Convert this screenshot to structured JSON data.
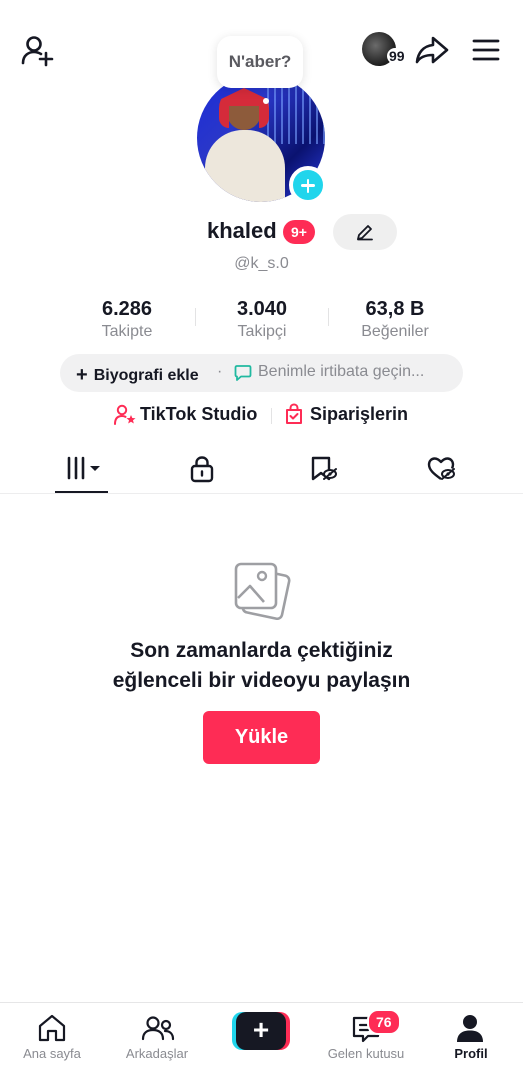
{
  "header": {
    "story_count": "99",
    "bubble_text": "N'aber?"
  },
  "profile": {
    "username": "khaled",
    "notification_badge": "9+",
    "handle": "@k_s.0"
  },
  "stats": [
    {
      "value": "6.286",
      "label": "Takipte"
    },
    {
      "value": "3.040",
      "label": "Takipçi"
    },
    {
      "value": "63,8 B",
      "label": "Beğeniler"
    }
  ],
  "bio": {
    "add_label": "Biyografi ekle",
    "separator": "·",
    "contact_label": "Benimle irtibata geçin..."
  },
  "links": {
    "studio": "TikTok Studio",
    "orders": "Siparişlerin"
  },
  "empty_state": {
    "title_line1": "Son zamanlarda çektiğiniz",
    "title_line2": "eğlenceli bir videoyu paylaşın",
    "upload_label": "Yükle"
  },
  "bottom_nav": {
    "home": "Ana sayfa",
    "friends": "Arkadaşlar",
    "create": "+",
    "inbox": "Gelen kutusu",
    "inbox_badge": "76",
    "profile": "Profil"
  },
  "colors": {
    "accent_red": "#fe2c55",
    "accent_cyan": "#20d5ec",
    "text_primary": "#161823",
    "text_secondary": "#8a8b91"
  }
}
